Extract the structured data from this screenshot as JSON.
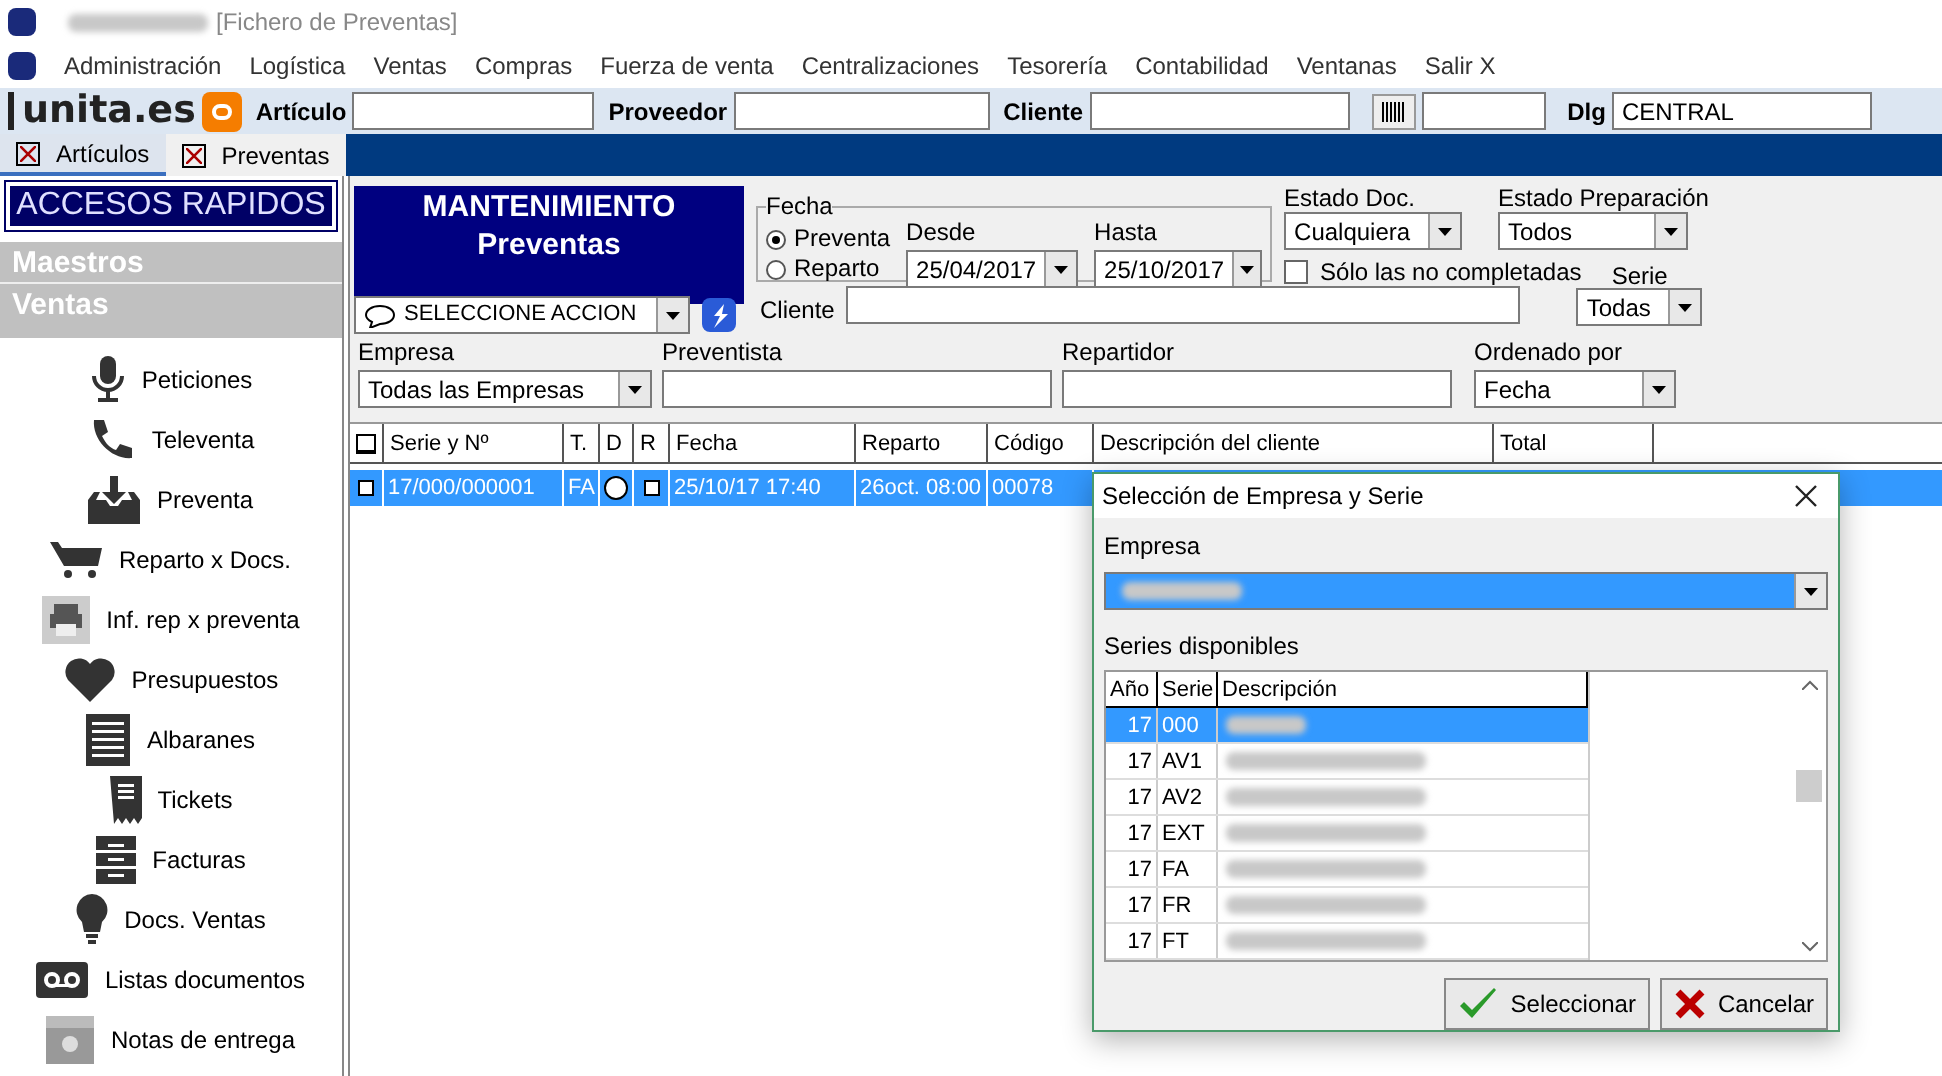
{
  "window": {
    "title": "[Fichero de Preventas]"
  },
  "menu": [
    "Administración",
    "Logística",
    "Ventas",
    "Compras",
    "Fuerza de venta",
    "Centralizaciones",
    "Tesorería",
    "Contabilidad",
    "Ventanas",
    "Salir X"
  ],
  "toolbar": {
    "logo": "unita.es",
    "fields": [
      {
        "label": "Artículo"
      },
      {
        "label": "Proveedor"
      },
      {
        "label": "Cliente"
      }
    ],
    "dlg_label": "Dlg",
    "dlg_value": "CENTRAL"
  },
  "tabs": [
    {
      "label": "Artículos",
      "selected": false
    },
    {
      "label": "Preventas",
      "selected": true
    }
  ],
  "sidebar": {
    "title": "ACCESOS RAPIDOS",
    "sections": [
      {
        "label": "Maestros",
        "expanded": false
      },
      {
        "label": "Ventas",
        "expanded": true
      }
    ],
    "items": [
      {
        "label": "Peticiones"
      },
      {
        "label": "Televenta"
      },
      {
        "label": "Preventa"
      },
      {
        "label": "Reparto x Docs."
      },
      {
        "label": "Inf. rep x preventa"
      },
      {
        "label": "Presupuestos"
      },
      {
        "label": "Albaranes"
      },
      {
        "label": "Tickets"
      },
      {
        "label": "Facturas"
      },
      {
        "label": "Docs. Ventas"
      },
      {
        "label": "Listas documentos"
      },
      {
        "label": "Notas de entrega"
      }
    ]
  },
  "header": {
    "line1": "MANTENIMIENTO",
    "line2": "Preventas"
  },
  "filters": {
    "fecha": {
      "label": "Fecha",
      "options": [
        {
          "label": "Preventa",
          "selected": true
        },
        {
          "label": "Reparto",
          "selected": false
        }
      ],
      "desde_label": "Desde",
      "desde": "25/04/2017",
      "hasta_label": "Hasta",
      "hasta": "25/10/2017"
    },
    "estado_doc": {
      "label": "Estado Doc.",
      "value": "Cualquiera"
    },
    "estado_prep": {
      "label": "Estado Preparación",
      "value": "Todos"
    },
    "only_incomplete": {
      "label": "Sólo las no completadas",
      "checked": false
    },
    "accion": "SELECCIONE ACCION",
    "cliente": {
      "label": "Cliente"
    },
    "serie": {
      "label": "Serie",
      "value": "Todas"
    },
    "empresa": {
      "label": "Empresa",
      "value": "Todas las Empresas"
    },
    "preventista": {
      "label": "Preventista"
    },
    "repartidor": {
      "label": "Repartidor"
    },
    "ordenado": {
      "label": "Ordenado por",
      "value": "Fecha"
    }
  },
  "table": {
    "columns": [
      "Serie y Nº",
      "T.",
      "D",
      "R",
      "Fecha",
      "Reparto",
      "Código",
      "Descripción del cliente",
      "Total"
    ],
    "rows": [
      {
        "selected": true,
        "serie": "17/000/000001",
        "t": "FA",
        "d": false,
        "r": false,
        "fecha": "25/10/17 17:40",
        "reparto": "26oct. 08:00",
        "codigo": "00078"
      }
    ]
  },
  "dialog": {
    "title": "Selección de Empresa y Serie",
    "empresa_label": "Empresa",
    "series_label": "Series disponibles",
    "columns": [
      "Año",
      "Serie",
      "Descripción"
    ],
    "rows": [
      {
        "year": "17",
        "serie": "000",
        "selected": true
      },
      {
        "year": "17",
        "serie": "AV1",
        "selected": false
      },
      {
        "year": "17",
        "serie": "AV2",
        "selected": false
      },
      {
        "year": "17",
        "serie": "EXT",
        "selected": false
      },
      {
        "year": "17",
        "serie": "FA",
        "selected": false
      },
      {
        "year": "17",
        "serie": "FR",
        "selected": false
      },
      {
        "year": "17",
        "serie": "FT",
        "selected": false
      }
    ],
    "buttons": [
      {
        "label": "Seleccionar",
        "kind": "ok"
      },
      {
        "label": "Cancelar",
        "kind": "cancel"
      }
    ]
  }
}
